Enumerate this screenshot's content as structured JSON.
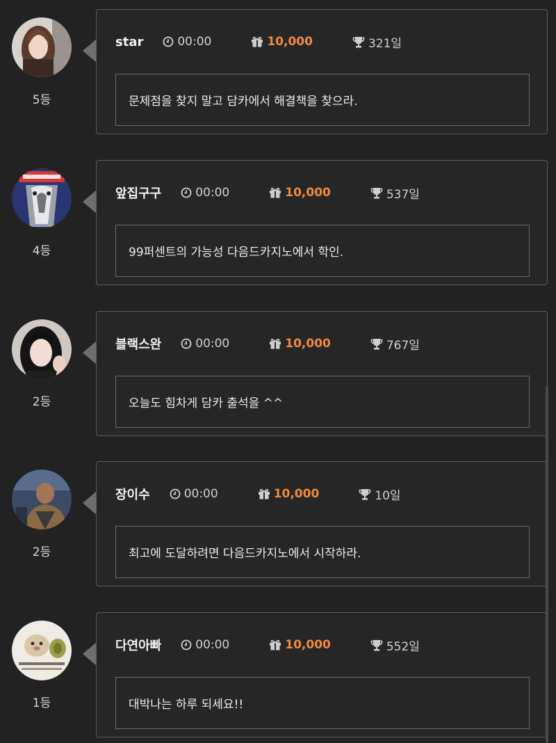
{
  "entries": [
    {
      "name": "star",
      "time": "00:00",
      "points": "10,000",
      "days": "321일",
      "message": "문제점을 찾지 말고 담카에서 해결책을 찾으라.",
      "rank": "5등"
    },
    {
      "name": "앞집구구",
      "time": "00:00",
      "points": "10,000",
      "days": "537일",
      "message": "99퍼센트의 가능성 다음드카지노에서 학인.",
      "rank": "4등"
    },
    {
      "name": "블랙스완",
      "time": "00:00",
      "points": "10,000",
      "days": "767일",
      "message": "오늘도 힘차게 담카 출석을 ^^",
      "rank": "2등"
    },
    {
      "name": "장이수",
      "time": "00:00",
      "points": "10,000",
      "days": "10일",
      "message": "최고에 도달하려면 다음드카지노에서 시작하라.",
      "rank": "2등"
    },
    {
      "name": "다연아빠",
      "time": "00:00",
      "points": "10,000",
      "days": "552일",
      "message": "대박나는 하루 되세요!!",
      "rank": "1등"
    }
  ],
  "icons": {
    "time": "clock-icon",
    "points": "gift-icon",
    "days": "trophy-icon"
  },
  "colors": {
    "background": "#222222",
    "points_accent": "#f08a3c",
    "card_border": "#5c5c5c"
  }
}
